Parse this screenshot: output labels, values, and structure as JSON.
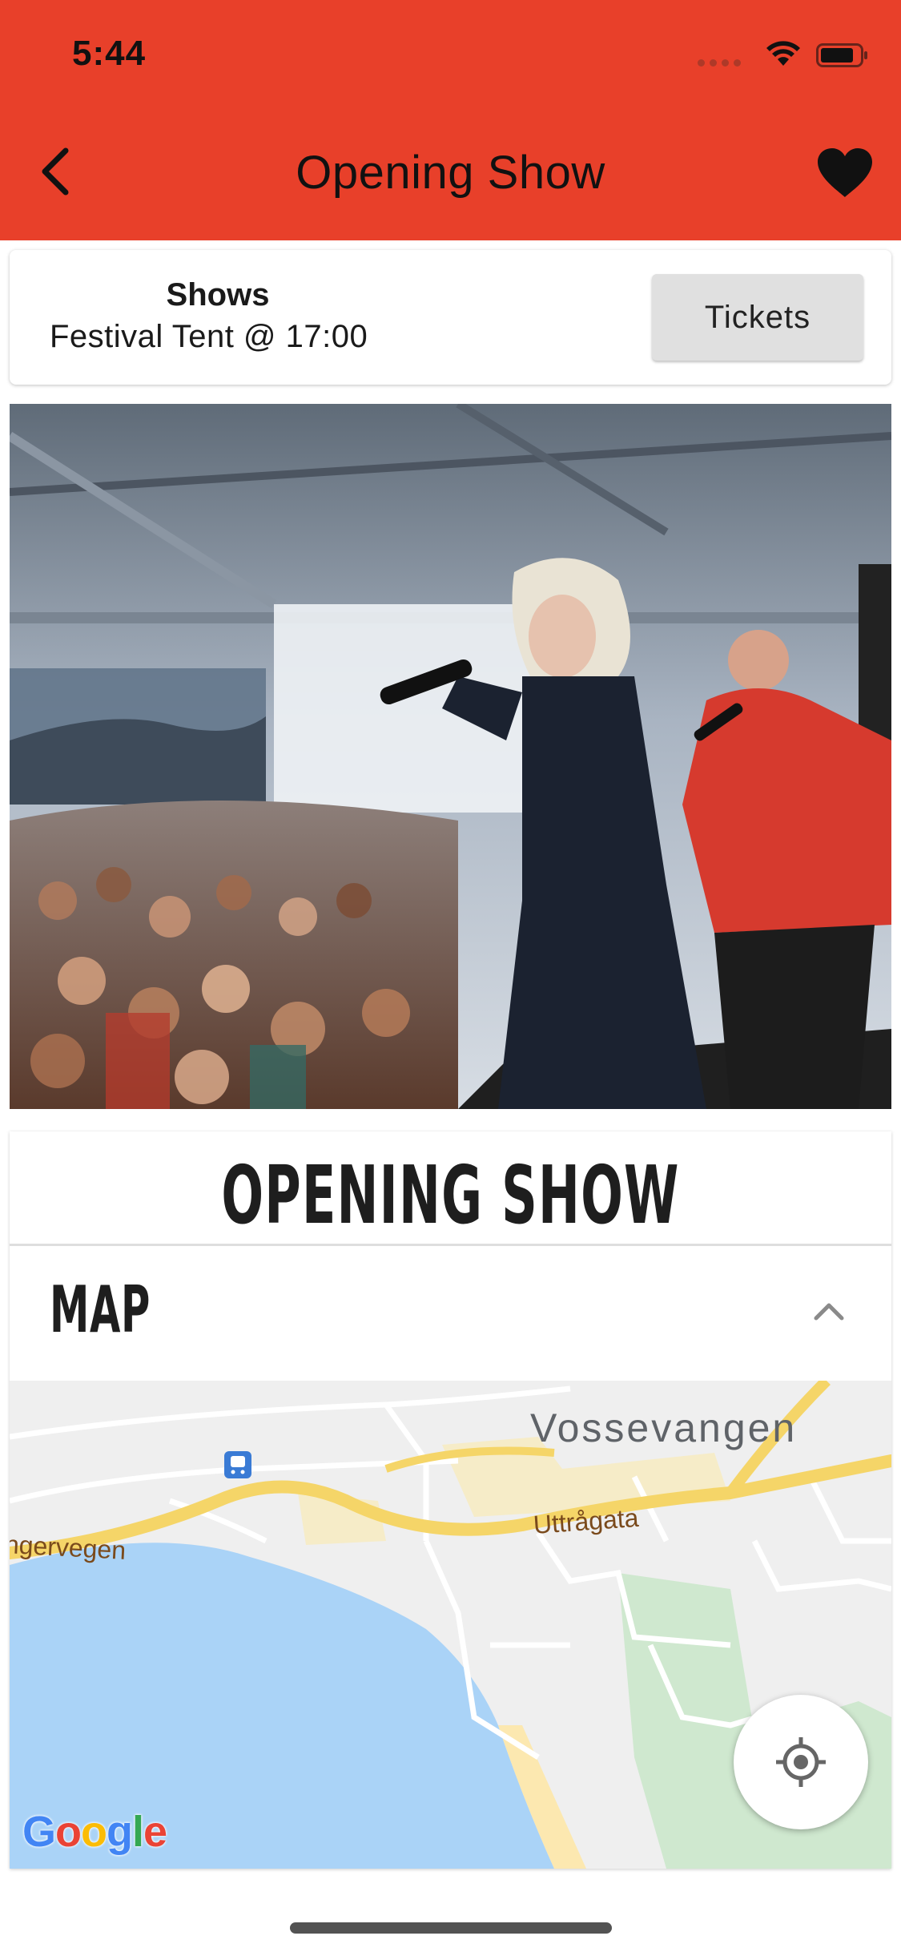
{
  "status_bar": {
    "time": "5:44"
  },
  "header": {
    "title": "Opening Show",
    "background_color": "#e8402a"
  },
  "show_card": {
    "title": "Shows",
    "venue": "Festival Tent @ 17:00",
    "tickets_label": "Tickets"
  },
  "event": {
    "heading": "OPENING SHOW"
  },
  "map_section": {
    "title": "MAP",
    "labels": {
      "town": "Vossevangen",
      "road": "Uttrågata",
      "road_west": "ngervegen"
    },
    "attribution": "Google"
  },
  "icons": {
    "back": "chevron-left-icon",
    "favorite": "heart-icon",
    "collapse": "chevron-up-icon",
    "locate": "my-location-icon",
    "transit": "train-station-icon"
  }
}
